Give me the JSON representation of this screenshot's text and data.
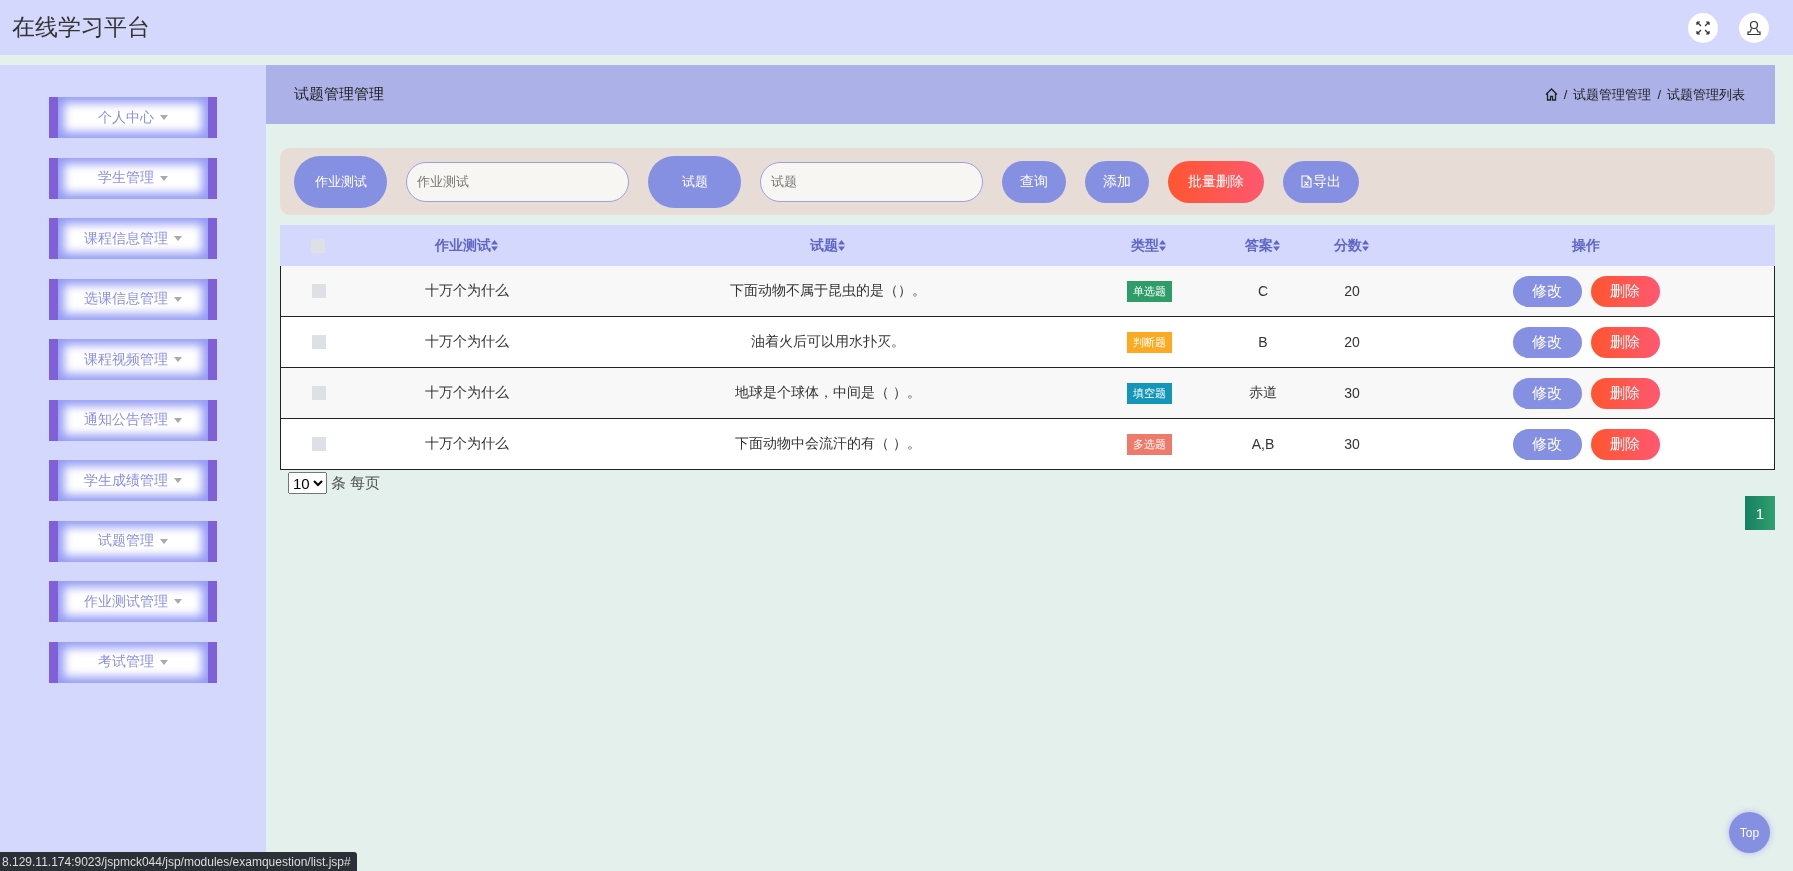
{
  "app": {
    "title": "在线学习平台"
  },
  "sidebar": {
    "items": [
      {
        "label": "个人中心"
      },
      {
        "label": "学生管理"
      },
      {
        "label": "课程信息管理"
      },
      {
        "label": "选课信息管理"
      },
      {
        "label": "课程视频管理"
      },
      {
        "label": "通知公告管理"
      },
      {
        "label": "学生成绩管理"
      },
      {
        "label": "试题管理"
      },
      {
        "label": "作业测试管理"
      },
      {
        "label": "考试管理"
      }
    ]
  },
  "breadcrumb": {
    "title": "试题管理管理",
    "separator": "/",
    "trail": [
      "试题管理管理",
      "试题管理列表"
    ]
  },
  "search": {
    "fields": [
      {
        "label": "作业测试",
        "placeholder": "作业测试"
      },
      {
        "label": "试题",
        "placeholder": "试题"
      }
    ],
    "buttons": [
      {
        "label": "查询",
        "kind": "primary"
      },
      {
        "label": "添加",
        "kind": "primary"
      },
      {
        "label": "批量删除",
        "kind": "danger"
      },
      {
        "label": "导出",
        "kind": "export"
      }
    ]
  },
  "table": {
    "header_checked": false,
    "columns": [
      {
        "label": "作业测试",
        "sortable": true
      },
      {
        "label": "试题",
        "sortable": true
      },
      {
        "label": "类型",
        "sortable": true
      },
      {
        "label": "答案",
        "sortable": true
      },
      {
        "label": "分数",
        "sortable": true
      },
      {
        "label": "操作",
        "sortable": false
      }
    ],
    "rows": [
      {
        "checked": false,
        "test": "十万个为什么",
        "question": "下面动物不属于昆虫的是（）。",
        "type": {
          "label": "单选题",
          "color": "#2e9d68"
        },
        "answer": "C",
        "score": "20",
        "actions": [
          "修改",
          "删除"
        ]
      },
      {
        "checked": false,
        "test": "十万个为什么",
        "question": "油着火后可以用水扑灭。",
        "type": {
          "label": "判断题",
          "color": "#fbaa22"
        },
        "answer": "B",
        "score": "20",
        "actions": [
          "修改",
          "删除"
        ]
      },
      {
        "checked": false,
        "test": "十万个为什么",
        "question": "地球是个球体，中间是（ ）。",
        "type": {
          "label": "填空题",
          "color": "#1496b8"
        },
        "answer": "赤道",
        "score": "30",
        "actions": [
          "修改",
          "删除"
        ]
      },
      {
        "checked": false,
        "test": "十万个为什么",
        "question": "下面动物中会流汗的有（ ）。",
        "type": {
          "label": "多选题",
          "color": "#f07a6a"
        },
        "answer": "A,B",
        "score": "30",
        "actions": [
          "修改",
          "删除"
        ]
      }
    ]
  },
  "pagination": {
    "page_size": "10",
    "page_size_label": "条 每页",
    "pages": [
      {
        "label": "1",
        "selected": true
      }
    ]
  },
  "back_to_top": "Top",
  "status_url": "8.129.11.174:9023/jspmck044/jsp/modules/examquestion/list.jsp#"
}
